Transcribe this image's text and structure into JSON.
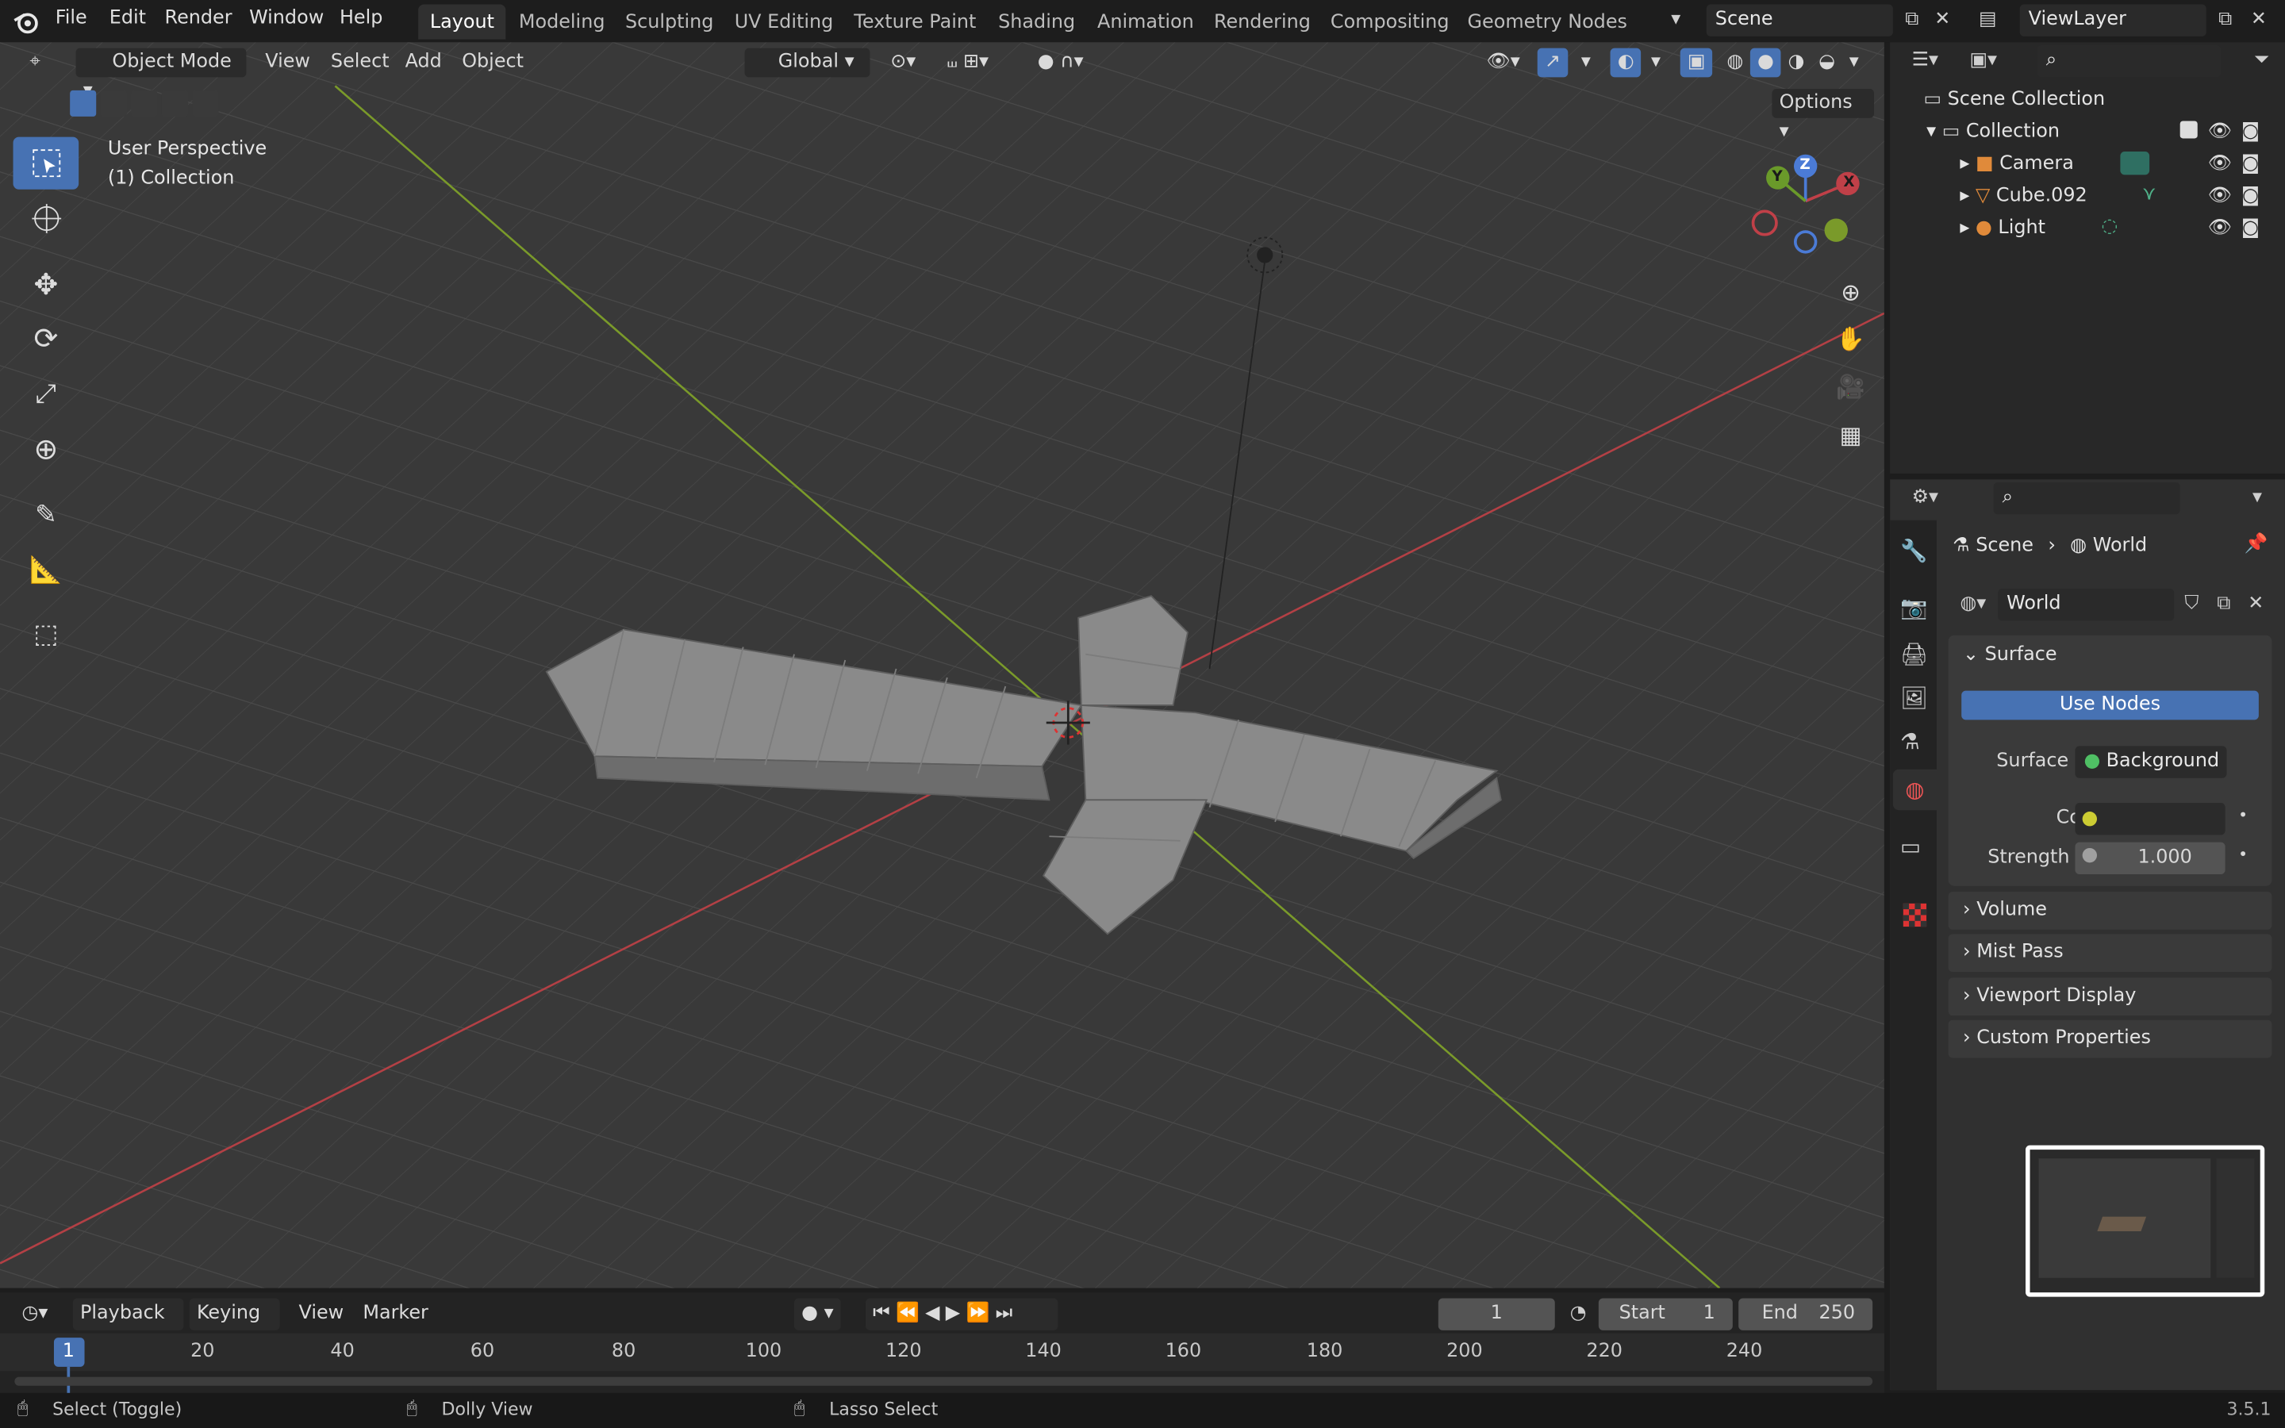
{
  "topbar": {
    "menus": [
      "File",
      "Edit",
      "Render",
      "Window",
      "Help"
    ],
    "workspaces": [
      "Layout",
      "Modeling",
      "Sculpting",
      "UV Editing",
      "Texture Paint",
      "Shading",
      "Animation",
      "Rendering",
      "Compositing",
      "Geometry Nodes"
    ],
    "scene": "Scene",
    "view_layer": "ViewLayer"
  },
  "viewport": {
    "mode": "Object Mode",
    "menus": [
      "View",
      "Select",
      "Add",
      "Object"
    ],
    "orientation": "Global",
    "options_label": "Options",
    "overlay_title": "User Perspective",
    "overlay_sub": "(1) Collection",
    "gizmo": {
      "x": "X",
      "y": "Y",
      "z": "Z"
    }
  },
  "outliner": {
    "root": "Scene Collection",
    "collection": "Collection",
    "items": [
      "Camera",
      "Cube.092",
      "Light"
    ]
  },
  "properties": {
    "breadcrumb": [
      "Scene",
      "World"
    ],
    "world_name": "World",
    "surface_title": "Surface",
    "use_nodes": "Use Nodes",
    "surface_label": "Surface",
    "surface_value": "Background",
    "color_label": "Color",
    "strength_label": "Strength",
    "strength_value": "1.000",
    "panels": [
      "Volume",
      "Mist Pass",
      "Viewport Display",
      "Custom Properties"
    ]
  },
  "timeline": {
    "menus": [
      "Playback",
      "Keying",
      "View",
      "Marker"
    ],
    "current_frame": "1",
    "start_label": "Start",
    "start": "1",
    "end_label": "End",
    "end": "250",
    "ticks": [
      "1",
      "20",
      "40",
      "60",
      "80",
      "100",
      "120",
      "140",
      "160",
      "180",
      "200",
      "220",
      "240"
    ]
  },
  "status": {
    "left": "Select (Toggle)",
    "mid": "Dolly View",
    "right": "Lasso Select",
    "version": "3.5.1"
  },
  "colors": {
    "accent": "#4772b3",
    "x_axis": "#b34045",
    "y_axis": "#7a9a2a"
  }
}
